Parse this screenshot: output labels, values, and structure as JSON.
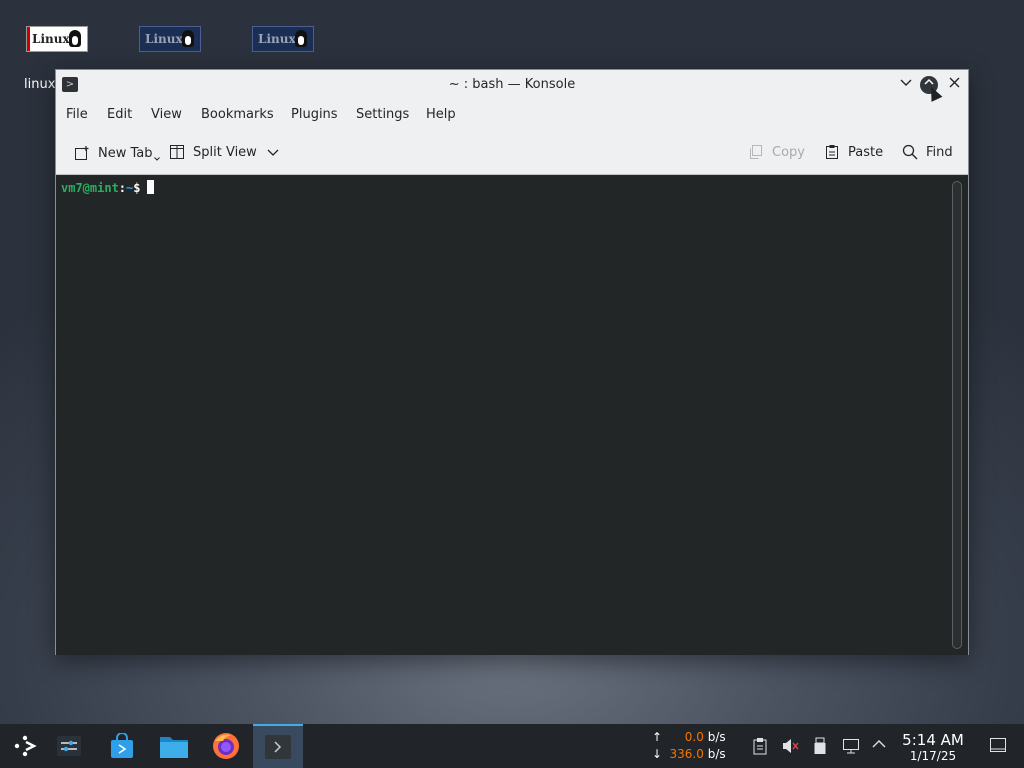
{
  "desktop": {
    "icons": [
      {
        "label": "Linux"
      },
      {
        "label": "Linux"
      },
      {
        "label": "Linux"
      }
    ],
    "label_text": "linux"
  },
  "window": {
    "title": "~ : bash — Konsole",
    "menu": [
      "File",
      "Edit",
      "View",
      "Bookmarks",
      "Plugins",
      "Settings",
      "Help"
    ],
    "toolbar": {
      "new_tab": "New Tab",
      "split_view": "Split View",
      "copy": "Copy",
      "paste": "Paste",
      "find": "Find"
    }
  },
  "terminal": {
    "user": "vm7@mint",
    "colon": ":",
    "path": "~",
    "dollar": "$"
  },
  "taskbar": {
    "net_up": "0.0",
    "net_down": "336.0",
    "unit": "b/s",
    "up_arrow": "↑",
    "down_arrow": "↓",
    "time": "5:14 AM",
    "date": "1/17/25"
  },
  "colors": {
    "accent": "#3daee9",
    "terminal_bg": "#232627",
    "prompt_user": "#27ae60",
    "prompt_path": "#2e9fe8",
    "net_value": "#f67400"
  }
}
